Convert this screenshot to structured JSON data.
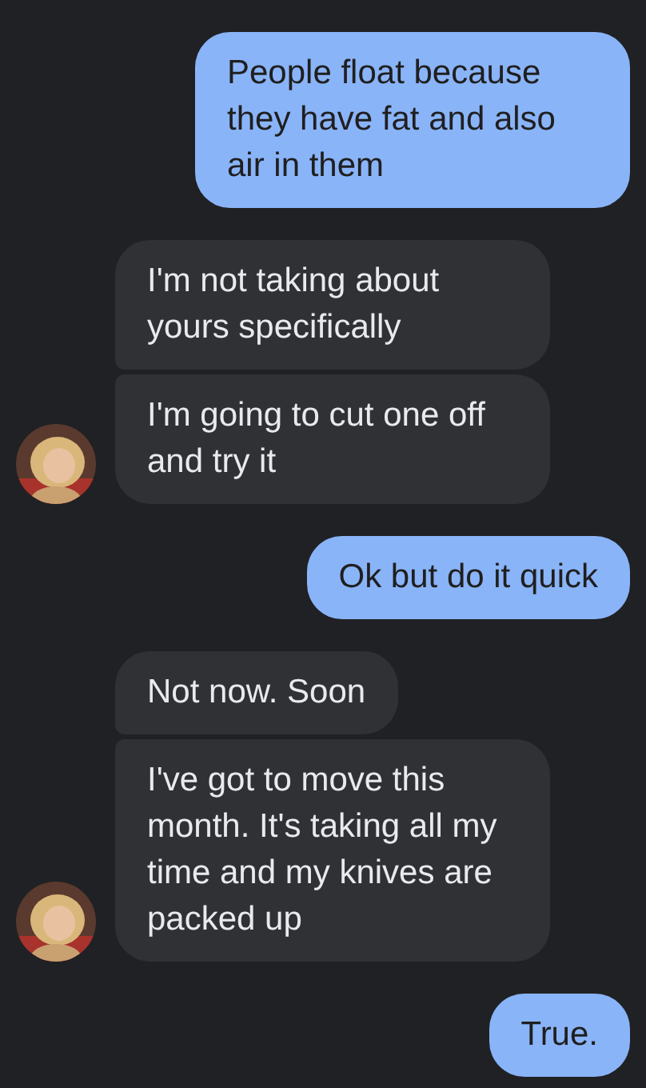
{
  "messages": [
    {
      "kind": "sent",
      "bubbles": [
        "People float because they have fat and also air in them"
      ]
    },
    {
      "kind": "received",
      "bubbles": [
        "I'm not taking about yours specifically",
        "I'm going to cut one off and try it"
      ]
    },
    {
      "kind": "sent",
      "bubbles": [
        "Ok but do it quick"
      ]
    },
    {
      "kind": "received",
      "bubbles": [
        "Not now. Soon",
        "I've got to move this month. It's taking all my time and my knives are packed up"
      ]
    },
    {
      "kind": "sent",
      "bubbles": [
        "True."
      ]
    }
  ]
}
